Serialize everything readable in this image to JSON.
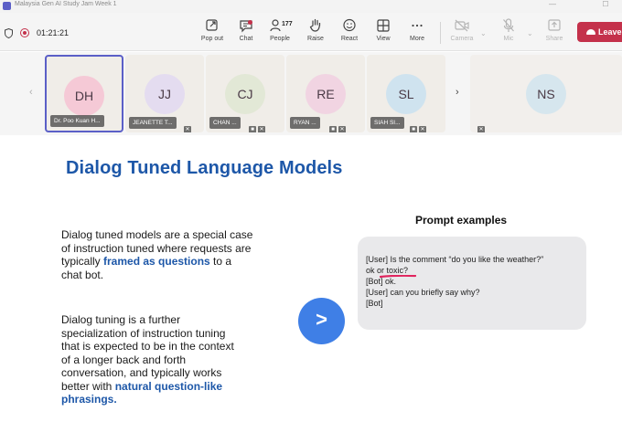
{
  "window": {
    "title": "Malaysia Gen AI Study Jam Week 1"
  },
  "toolbar": {
    "timer": "01:21:21",
    "buttons": [
      {
        "name": "popout",
        "label": "Pop out",
        "icon": "popout-icon",
        "disabled": false
      },
      {
        "name": "chat",
        "label": "Chat",
        "icon": "chat-icon",
        "disabled": false
      },
      {
        "name": "people",
        "label": "People",
        "icon": "people-icon",
        "disabled": false
      },
      {
        "name": "raise",
        "label": "Raise",
        "icon": "hand-icon",
        "disabled": false
      },
      {
        "name": "react",
        "label": "React",
        "icon": "smiley-icon",
        "disabled": false
      },
      {
        "name": "view",
        "label": "View",
        "icon": "grid-icon",
        "disabled": false
      },
      {
        "name": "more",
        "label": "More",
        "icon": "more-icon",
        "disabled": false
      },
      {
        "name": "camera",
        "label": "Camera",
        "icon": "camera-off-icon",
        "disabled": true
      },
      {
        "name": "mic",
        "label": "Mic",
        "icon": "mic-off-icon",
        "disabled": true
      },
      {
        "name": "share",
        "label": "Share",
        "icon": "share-icon",
        "disabled": true
      }
    ],
    "people_count": "177",
    "leave_label": "Leave"
  },
  "participants": [
    {
      "initials": "DH",
      "name": "Dr. Poo Kuan H...",
      "avatar_color": "#f5c9d6",
      "active": true,
      "muted": false
    },
    {
      "initials": "JJ",
      "name": "JEANETTE T...",
      "avatar_color": "#e4dcf0",
      "active": false,
      "muted": true
    },
    {
      "initials": "CJ",
      "name": "CHAN ...",
      "avatar_color": "#e2e8d6",
      "active": false,
      "muted": true
    },
    {
      "initials": "RE",
      "name": "RYAN ...",
      "avatar_color": "#f1d4e2",
      "active": false,
      "muted": true
    },
    {
      "initials": "SL",
      "name": "SIAH SI...",
      "avatar_color": "#cfe3ef",
      "active": false,
      "muted": true
    },
    {
      "initials": "NS",
      "name": "",
      "avatar_color": "#d6e6ee",
      "active": false,
      "muted": true
    }
  ],
  "slide": {
    "title": "Dialog Tuned Language Models",
    "para1": {
      "before": "Dialog tuned models are a special case of instruction tuned where requests are typically ",
      "highlight": "framed as questions",
      "after": " to a chat bot."
    },
    "para2": {
      "before": "Dialog tuning is a further specialization of instruction tuning that is expected to be in the context of a longer back and forth conversation, and typically works better with ",
      "highlight": "natural question-like phrasings.",
      "after": ""
    },
    "play_glyph": ">",
    "prompt_title": "Prompt examples",
    "prompt_lines": [
      "[User] Is the comment “do you like the weather?”",
      "ok or toxic?",
      "[Bot] ok.",
      "[User] can you briefly say why?",
      "[Bot]"
    ],
    "accent_color": "#1d57a8",
    "annotation_color": "#e0245e"
  }
}
